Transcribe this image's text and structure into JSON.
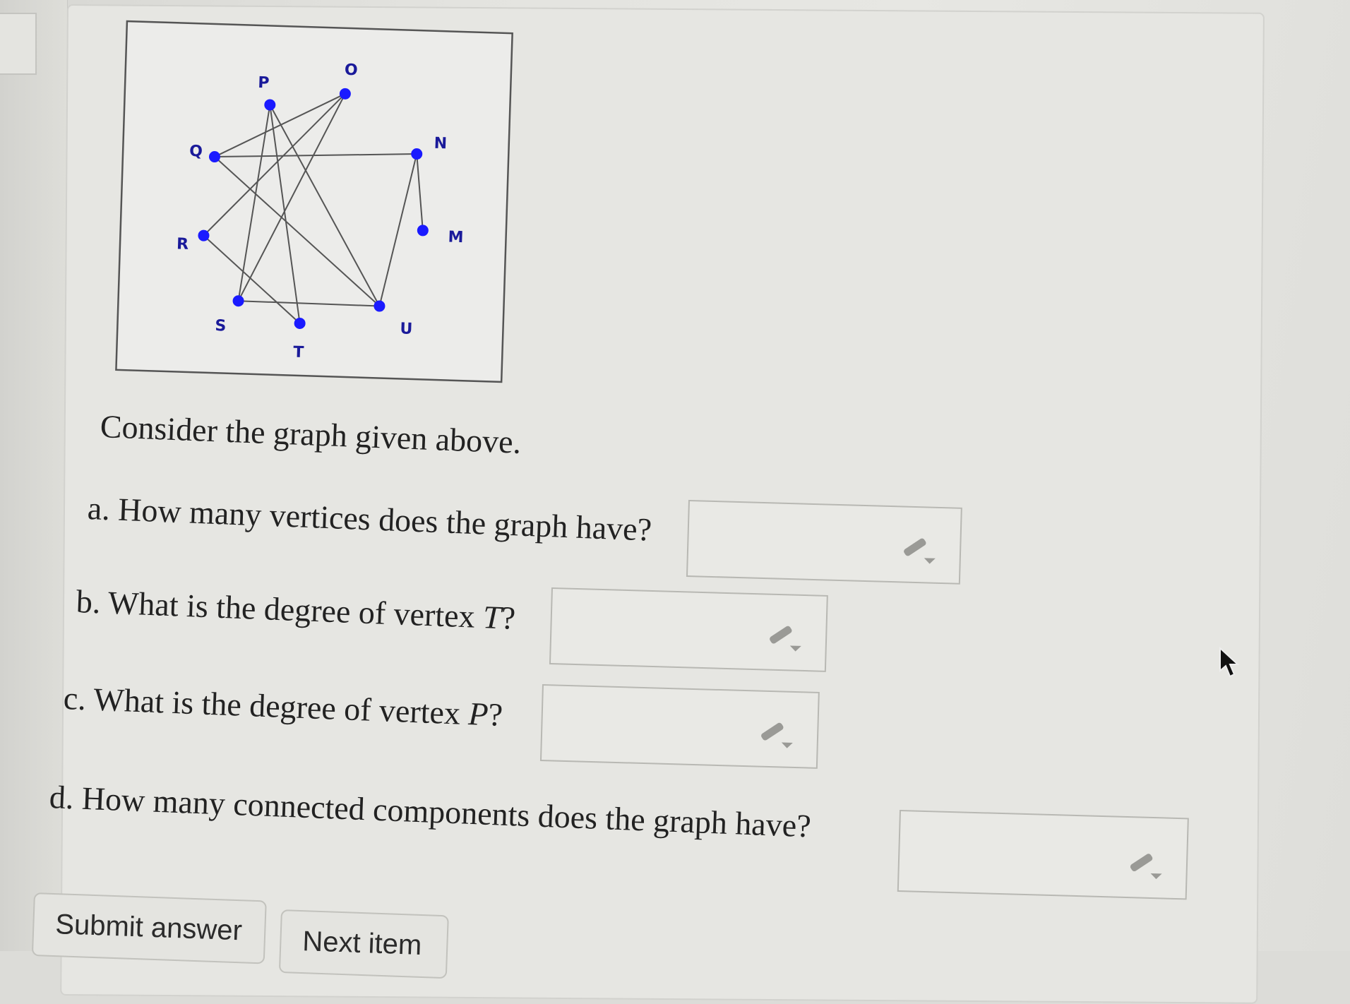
{
  "graph": {
    "vertex_labels": [
      "P",
      "O",
      "N",
      "M",
      "Q",
      "R",
      "S",
      "T",
      "U"
    ],
    "vertex_color": "#1a1aff",
    "edge_color": "#555555"
  },
  "question": {
    "intro": "Consider the graph given above.",
    "parts": [
      {
        "prefix": "a.",
        "text": "How many vertices does the graph have?"
      },
      {
        "prefix": "b.",
        "text": "What is the degree of vertex",
        "var": "T",
        "suffix": "?"
      },
      {
        "prefix": "c.",
        "text": "What is the degree of vertex",
        "var": "P",
        "suffix": "?"
      },
      {
        "prefix": "d.",
        "text": "How many connected components does the graph have?"
      }
    ]
  },
  "answers": [
    "",
    "",
    "",
    ""
  ],
  "buttons": {
    "submit": "Submit answer",
    "next": "Next item"
  },
  "icons": {
    "pencil": "pencil-dropdown-icon",
    "cursor": "mouse-pointer-icon"
  }
}
